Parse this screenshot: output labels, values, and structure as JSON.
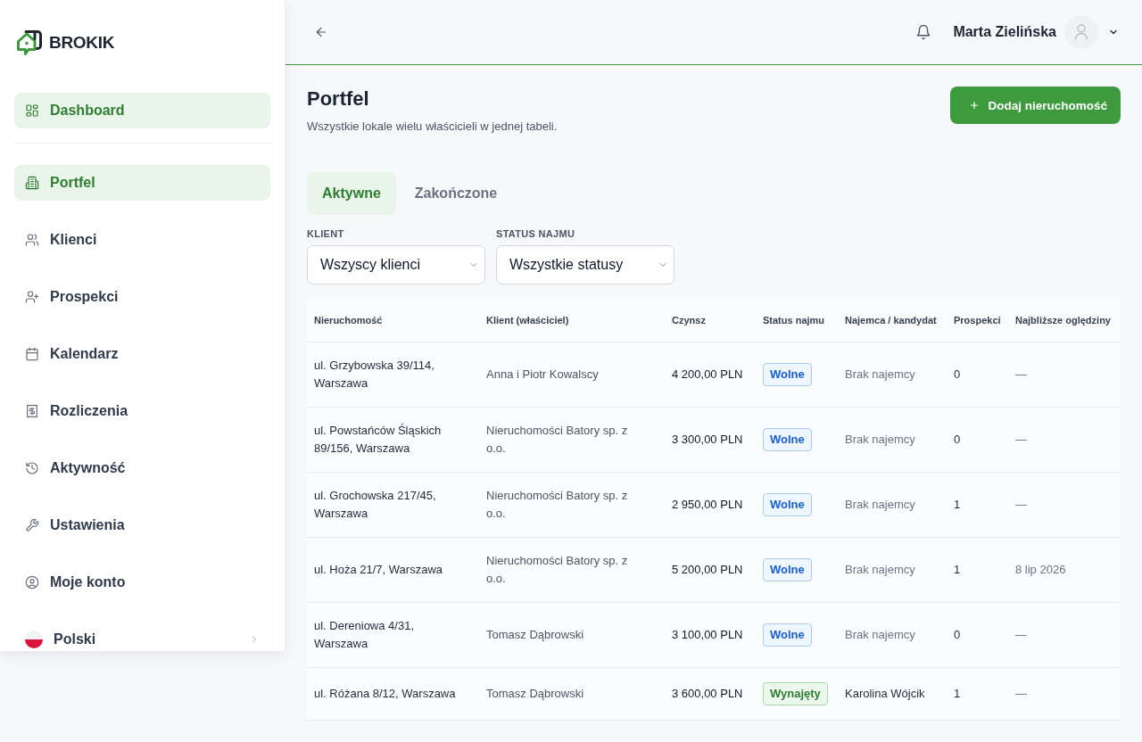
{
  "sidebar": {
    "logo": {
      "text": "BROKIK"
    },
    "groups": [
      {
        "items": [
          {
            "label": "Dashboard",
            "selected": true
          }
        ]
      },
      {
        "items": [
          {
            "label": "Portfel",
            "selected": true
          },
          {
            "label": "Klienci",
            "selected": false
          },
          {
            "label": "Prospekci",
            "selected": false
          },
          {
            "label": "Kalendarz",
            "selected": false
          },
          {
            "label": "Rozliczenia",
            "selected": false
          },
          {
            "label": "Aktywność",
            "selected": false
          },
          {
            "label": "Ustawienia",
            "selected": false
          },
          {
            "label": "Moje konto",
            "selected": false
          }
        ]
      }
    ],
    "language": {
      "label": "Polski"
    }
  },
  "header": {
    "user_name": "Marta Zielińska"
  },
  "page": {
    "title": "Portfel",
    "subtitle": "Wszystkie lokale wielu właścicieli w jednej tabeli.",
    "add_button": "Dodaj nieruchomość"
  },
  "tabs": [
    {
      "label": "Aktywne",
      "selected": true
    },
    {
      "label": "Zakończone",
      "selected": false
    }
  ],
  "filters": [
    {
      "label": "KLIENT",
      "value": "Wszyscy klienci"
    },
    {
      "label": "STATUS NAJMU",
      "value": "Wszystkie statusy"
    }
  ],
  "table": {
    "columns": [
      "Nieruchomość",
      "Klient (właściciel)",
      "Czynsz",
      "Status najmu",
      "Najemca / kandydat",
      "Prospekci",
      "Najbliższe oględziny"
    ],
    "rows": [
      {
        "property": "ul. Grzybowska 39/114, Warszawa",
        "client": "Anna i Piotr Kowalscy",
        "rent": "4 200,00 PLN",
        "status": {
          "label": "Wolne",
          "kind": "vacant"
        },
        "tenant": "Brak najemcy",
        "prospects": "0",
        "next_viewing": "—"
      },
      {
        "property": "ul. Powstańców Śląskich 89/156, Warszawa",
        "client": "Nieruchomości Batory sp. z o.o.",
        "rent": "3 300,00 PLN",
        "status": {
          "label": "Wolne",
          "kind": "vacant"
        },
        "tenant": "Brak najemcy",
        "prospects": "0",
        "next_viewing": "—"
      },
      {
        "property": "ul. Grochowska 217/45, Warszawa",
        "client": "Nieruchomości Batory sp. z o.o.",
        "rent": "2 950,00 PLN",
        "status": {
          "label": "Wolne",
          "kind": "vacant"
        },
        "tenant": "Brak najemcy",
        "prospects": "1",
        "next_viewing": "—"
      },
      {
        "property": "ul. Hoża 21/7, Warszawa",
        "client": "Nieruchomości Batory sp. z o.o.",
        "rent": "5 200,00 PLN",
        "status": {
          "label": "Wolne",
          "kind": "vacant"
        },
        "tenant": "Brak najemcy",
        "prospects": "1",
        "next_viewing": "8 lip 2026"
      },
      {
        "property": "ul. Dereniowa 4/31, Warszawa",
        "client": "Tomasz Dąbrowski",
        "rent": "3 100,00 PLN",
        "status": {
          "label": "Wolne",
          "kind": "vacant"
        },
        "tenant": "Brak najemcy",
        "prospects": "0",
        "next_viewing": "—"
      },
      {
        "property": "ul. Różana 8/12, Warszawa",
        "client": "Tomasz Dąbrowski",
        "rent": "3 600,00 PLN",
        "status": {
          "label": "Wynajęty",
          "kind": "rented"
        },
        "tenant": "Karolina Wójcik",
        "prospects": "1",
        "next_viewing": "—"
      }
    ]
  }
}
